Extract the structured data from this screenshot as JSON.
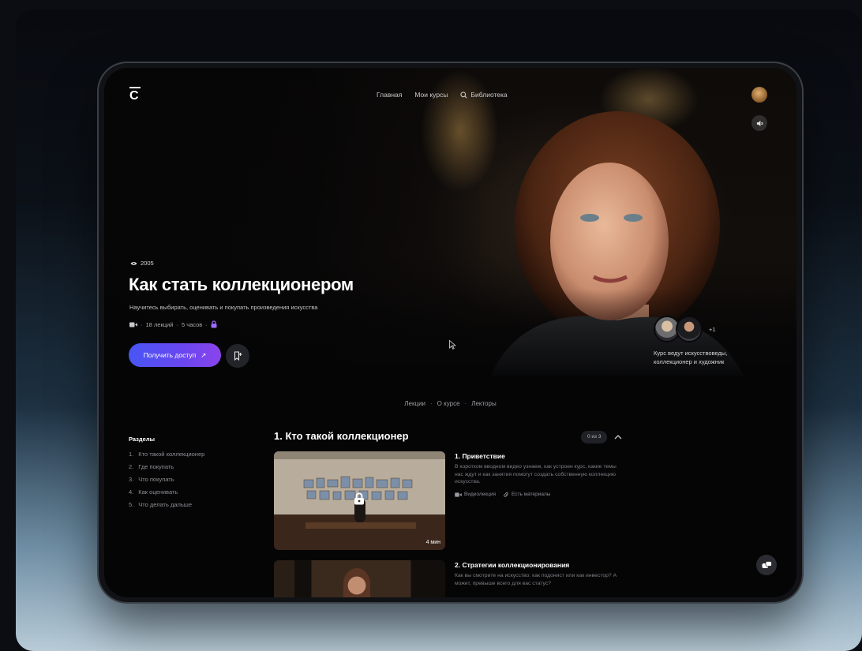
{
  "app": {
    "logo_letter": "C",
    "nav": [
      {
        "label": "Главная",
        "icon": ""
      },
      {
        "label": "Мои курсы",
        "icon": ""
      },
      {
        "label": "Библиотека",
        "icon": "search-icon"
      }
    ]
  },
  "course": {
    "views": "2005",
    "title": "Как стать коллекционером",
    "subtitle": "Научитесь выбирать, оценивать и покупать произведения искусства",
    "lectures": "18 лекций",
    "duration": "5 часов",
    "cta_label": "Получить доступ",
    "cta_arrow": "↗"
  },
  "lecturers": {
    "more": "+1",
    "caption": "Курс ведут искусствоведы, коллекционер и художник"
  },
  "section_tabs": [
    "Лекции",
    "О курсе",
    "Лекторы"
  ],
  "sidebar": {
    "heading": "Разделы",
    "items": [
      {
        "num": "1.",
        "label": "Кто такой коллекционер"
      },
      {
        "num": "2.",
        "label": "Где покупать"
      },
      {
        "num": "3.",
        "label": "Что покупать"
      },
      {
        "num": "4.",
        "label": "Как оценивать"
      },
      {
        "num": "5.",
        "label": "Что делать дальше"
      }
    ]
  },
  "block": {
    "title": "1. Кто такой коллекционер",
    "progress": "0 из 3",
    "lessons": [
      {
        "title": "1. Приветствие",
        "desc": "В коротком вводном видео узнаем, как устроен курс, какие темы нас ждут и как занятия помогут создать собственную коллекцию искусства.",
        "tag_video": "Видеолекция",
        "tag_materials": "Есть материалы",
        "duration": "4 мин"
      },
      {
        "title": "2. Стратегии коллекционирования",
        "desc": "Как вы смотрите на искусство: как подонист или как инвестор? А может, превыше всего для вас статус?"
      }
    ]
  },
  "colors": {
    "accent_start": "#4856f4",
    "accent_end": "#8a44ec",
    "lock": "#a06cff"
  }
}
